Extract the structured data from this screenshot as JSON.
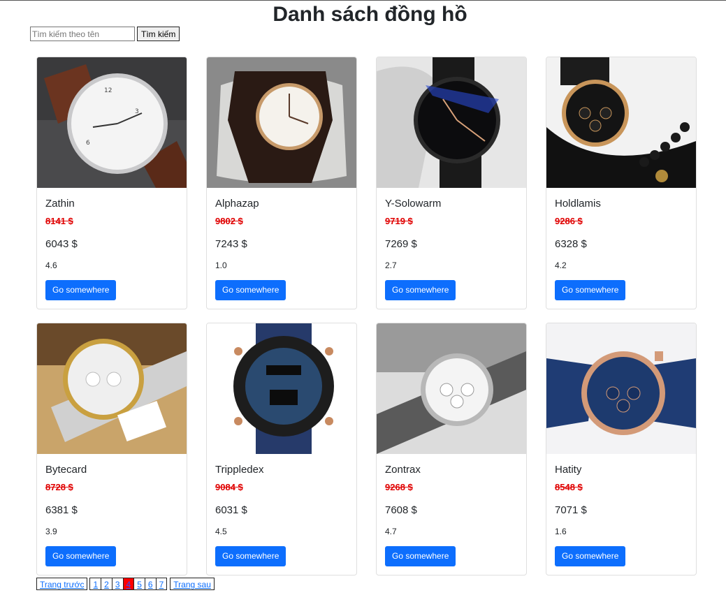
{
  "page": {
    "title": "Danh sách đồng hồ"
  },
  "search": {
    "placeholder": "Tìm kiếm theo tên",
    "value": "",
    "button_label": "Tìm kiếm"
  },
  "products": [
    {
      "name": "Zathin",
      "old_price": "8141 $",
      "price": "6043 $",
      "rating": "4.6",
      "button_label": "Go somewhere"
    },
    {
      "name": "Alphazap",
      "old_price": "9802 $",
      "price": "7243 $",
      "rating": "1.0",
      "button_label": "Go somewhere"
    },
    {
      "name": "Y-Solowarm",
      "old_price": "9719 $",
      "price": "7269 $",
      "rating": "2.7",
      "button_label": "Go somewhere"
    },
    {
      "name": "Holdlamis",
      "old_price": "9286 $",
      "price": "6328 $",
      "rating": "4.2",
      "button_label": "Go somewhere"
    },
    {
      "name": "Bytecard",
      "old_price": "8728 $",
      "price": "6381 $",
      "rating": "3.9",
      "button_label": "Go somewhere"
    },
    {
      "name": "Trippledex",
      "old_price": "9084 $",
      "price": "6031 $",
      "rating": "4.5",
      "button_label": "Go somewhere"
    },
    {
      "name": "Zontrax",
      "old_price": "9268 $",
      "price": "7608 $",
      "rating": "4.7",
      "button_label": "Go somewhere"
    },
    {
      "name": "Hatity",
      "old_price": "8548 $",
      "price": "7071 $",
      "rating": "1.6",
      "button_label": "Go somewhere"
    }
  ],
  "pagination": {
    "prev_label": "Trang trước",
    "next_label": "Trang sau",
    "pages": [
      "1",
      "2",
      "3",
      "4",
      "5",
      "6",
      "7"
    ],
    "current_page": "4"
  },
  "colors": {
    "accent": "#0d6efd",
    "old_price": "#e00000",
    "active_page": "#ff0000"
  }
}
